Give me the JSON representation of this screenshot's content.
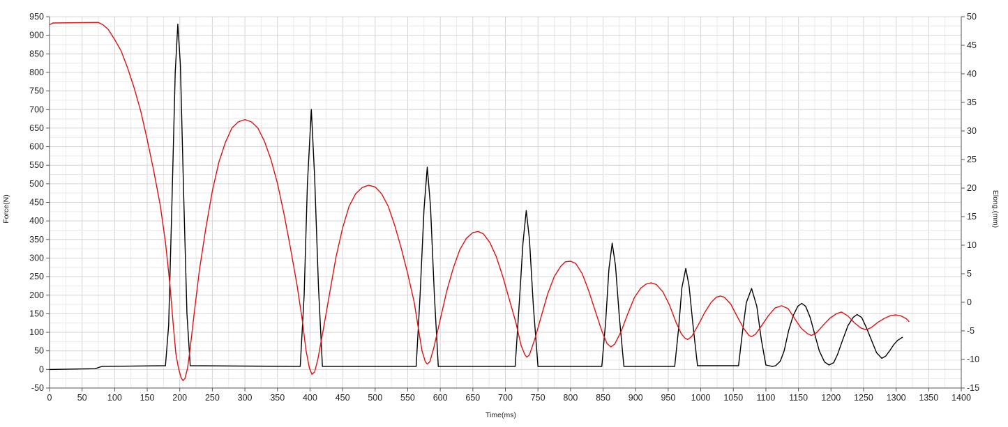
{
  "chart_data": {
    "type": "line",
    "title": "",
    "xlabel": "Time(ms)",
    "ylabel": "Force(N)",
    "y2label": "Elong.(mm)",
    "xlim": [
      0,
      1400
    ],
    "ylim": [
      -50,
      950
    ],
    "y2lim": [
      -15,
      50
    ],
    "grid": true,
    "legend": "none",
    "x_ticks": [
      "0",
      "50",
      "100",
      "150",
      "200",
      "250",
      "300",
      "350",
      "400",
      "450",
      "500",
      "550",
      "600",
      "650",
      "700",
      "750",
      "800",
      "850",
      "900",
      "950",
      "1000",
      "1050",
      "1100",
      "1150",
      "1200",
      "1250",
      "1300",
      "1350",
      "1400"
    ],
    "y_ticks": [
      "-50",
      "0",
      "50",
      "100",
      "150",
      "200",
      "250",
      "300",
      "350",
      "400",
      "450",
      "500",
      "550",
      "600",
      "650",
      "700",
      "750",
      "800",
      "850",
      "900",
      "950"
    ],
    "y2_ticks": [
      "-15",
      "-10",
      "-5",
      "0",
      "5",
      "10",
      "15",
      "20",
      "25",
      "30",
      "35",
      "40",
      "45",
      "50"
    ],
    "colors": {
      "force": "#000000",
      "elong": "#e01010",
      "grid": "#d4d4d4",
      "axis": "#555555"
    },
    "series": [
      {
        "axis": "left",
        "color": "#000000",
        "points": [
          [
            0,
            0
          ],
          [
            70,
            2
          ],
          [
            80,
            8
          ],
          [
            178,
            10
          ],
          [
            183,
            120
          ],
          [
            188,
            450
          ],
          [
            193,
            800
          ],
          [
            197,
            930
          ],
          [
            201,
            820
          ],
          [
            206,
            470
          ],
          [
            211,
            150
          ],
          [
            216,
            10
          ],
          [
            385,
            8
          ],
          [
            391,
            200
          ],
          [
            396,
            500
          ],
          [
            402,
            700
          ],
          [
            407,
            520
          ],
          [
            413,
            220
          ],
          [
            419,
            8
          ],
          [
            563,
            8
          ],
          [
            569,
            200
          ],
          [
            575,
            430
          ],
          [
            580,
            545
          ],
          [
            585,
            440
          ],
          [
            591,
            200
          ],
          [
            597,
            8
          ],
          [
            715,
            8
          ],
          [
            721,
            170
          ],
          [
            727,
            340
          ],
          [
            732,
            428
          ],
          [
            737,
            350
          ],
          [
            743,
            170
          ],
          [
            750,
            8
          ],
          [
            848,
            8
          ],
          [
            854,
            130
          ],
          [
            859,
            270
          ],
          [
            864,
            340
          ],
          [
            869,
            280
          ],
          [
            875,
            140
          ],
          [
            882,
            8
          ],
          [
            960,
            8
          ],
          [
            966,
            110
          ],
          [
            971,
            220
          ],
          [
            977,
            272
          ],
          [
            982,
            225
          ],
          [
            988,
            120
          ],
          [
            995,
            10
          ],
          [
            1058,
            10
          ],
          [
            1064,
            100
          ],
          [
            1070,
            180
          ],
          [
            1078,
            218
          ],
          [
            1086,
            170
          ],
          [
            1093,
            80
          ],
          [
            1100,
            12
          ],
          [
            1110,
            8
          ],
          [
            1115,
            10
          ],
          [
            1122,
            22
          ],
          [
            1128,
            50
          ],
          [
            1135,
            105
          ],
          [
            1142,
            145
          ],
          [
            1149,
            170
          ],
          [
            1155,
            178
          ],
          [
            1161,
            170
          ],
          [
            1168,
            140
          ],
          [
            1175,
            95
          ],
          [
            1182,
            50
          ],
          [
            1190,
            20
          ],
          [
            1197,
            12
          ],
          [
            1204,
            18
          ],
          [
            1210,
            40
          ],
          [
            1218,
            80
          ],
          [
            1226,
            118
          ],
          [
            1234,
            140
          ],
          [
            1240,
            148
          ],
          [
            1247,
            140
          ],
          [
            1255,
            110
          ],
          [
            1263,
            75
          ],
          [
            1270,
            45
          ],
          [
            1278,
            30
          ],
          [
            1284,
            36
          ],
          [
            1290,
            50
          ],
          [
            1296,
            66
          ],
          [
            1302,
            78
          ],
          [
            1310,
            87
          ]
        ]
      },
      {
        "axis": "right",
        "color": "#e01010",
        "points": [
          [
            0,
            48.6
          ],
          [
            5,
            48.9
          ],
          [
            75,
            49.0
          ],
          [
            82,
            48.6
          ],
          [
            90,
            47.8
          ],
          [
            100,
            46.0
          ],
          [
            110,
            44.0
          ],
          [
            120,
            41.0
          ],
          [
            130,
            37.5
          ],
          [
            140,
            33.5
          ],
          [
            150,
            28.5
          ],
          [
            160,
            23.0
          ],
          [
            170,
            17.0
          ],
          [
            178,
            10.5
          ],
          [
            185,
            3.0
          ],
          [
            190,
            -4.0
          ],
          [
            194,
            -9.0
          ],
          [
            198,
            -11.5
          ],
          [
            202,
            -13.2
          ],
          [
            205,
            -13.7
          ],
          [
            208,
            -13.3
          ],
          [
            212,
            -11.5
          ],
          [
            216,
            -8.0
          ],
          [
            222,
            -2.0
          ],
          [
            230,
            5.5
          ],
          [
            240,
            13.0
          ],
          [
            250,
            19.5
          ],
          [
            260,
            24.5
          ],
          [
            270,
            28.0
          ],
          [
            280,
            30.5
          ],
          [
            290,
            31.6
          ],
          [
            300,
            32.0
          ],
          [
            310,
            31.6
          ],
          [
            320,
            30.5
          ],
          [
            330,
            28.2
          ],
          [
            340,
            25.0
          ],
          [
            350,
            20.8
          ],
          [
            360,
            15.5
          ],
          [
            370,
            9.5
          ],
          [
            380,
            3.0
          ],
          [
            388,
            -3.0
          ],
          [
            394,
            -8.5
          ],
          [
            399,
            -11.5
          ],
          [
            403,
            -12.6
          ],
          [
            407,
            -12.2
          ],
          [
            412,
            -10.0
          ],
          [
            420,
            -5.0
          ],
          [
            430,
            1.5
          ],
          [
            440,
            8.0
          ],
          [
            450,
            13.0
          ],
          [
            460,
            16.8
          ],
          [
            470,
            19.0
          ],
          [
            480,
            20.1
          ],
          [
            490,
            20.5
          ],
          [
            500,
            20.2
          ],
          [
            510,
            19.0
          ],
          [
            520,
            16.8
          ],
          [
            530,
            13.5
          ],
          [
            540,
            9.5
          ],
          [
            550,
            5.0
          ],
          [
            560,
            0.0
          ],
          [
            567,
            -5.0
          ],
          [
            572,
            -8.5
          ],
          [
            577,
            -10.4
          ],
          [
            580,
            -10.8
          ],
          [
            584,
            -10.4
          ],
          [
            590,
            -8.0
          ],
          [
            600,
            -3.0
          ],
          [
            610,
            2.0
          ],
          [
            620,
            6.0
          ],
          [
            630,
            9.2
          ],
          [
            640,
            11.2
          ],
          [
            650,
            12.2
          ],
          [
            658,
            12.4
          ],
          [
            666,
            12.0
          ],
          [
            676,
            10.5
          ],
          [
            686,
            8.0
          ],
          [
            696,
            4.5
          ],
          [
            706,
            0.5
          ],
          [
            716,
            -3.5
          ],
          [
            724,
            -7.5
          ],
          [
            730,
            -9.2
          ],
          [
            733,
            -9.6
          ],
          [
            737,
            -9.2
          ],
          [
            745,
            -6.5
          ],
          [
            755,
            -2.5
          ],
          [
            765,
            1.5
          ],
          [
            775,
            4.5
          ],
          [
            785,
            6.3
          ],
          [
            792,
            7.1
          ],
          [
            800,
            7.2
          ],
          [
            808,
            6.8
          ],
          [
            818,
            5.0
          ],
          [
            828,
            2.0
          ],
          [
            838,
            -1.5
          ],
          [
            848,
            -5.0
          ],
          [
            856,
            -7.2
          ],
          [
            862,
            -7.8
          ],
          [
            868,
            -7.3
          ],
          [
            878,
            -5.0
          ],
          [
            888,
            -2.0
          ],
          [
            898,
            0.8
          ],
          [
            908,
            2.5
          ],
          [
            916,
            3.2
          ],
          [
            924,
            3.4
          ],
          [
            932,
            3.1
          ],
          [
            942,
            1.8
          ],
          [
            952,
            -0.5
          ],
          [
            962,
            -3.5
          ],
          [
            970,
            -5.5
          ],
          [
            976,
            -6.3
          ],
          [
            980,
            -6.5
          ],
          [
            986,
            -6.0
          ],
          [
            996,
            -4.0
          ],
          [
            1006,
            -1.8
          ],
          [
            1016,
            0.0
          ],
          [
            1024,
            0.9
          ],
          [
            1030,
            1.1
          ],
          [
            1036,
            0.9
          ],
          [
            1046,
            -0.3
          ],
          [
            1056,
            -2.5
          ],
          [
            1066,
            -4.6
          ],
          [
            1074,
            -5.8
          ],
          [
            1078,
            -6.0
          ],
          [
            1084,
            -5.6
          ],
          [
            1094,
            -4.0
          ],
          [
            1104,
            -2.3
          ],
          [
            1114,
            -1.0
          ],
          [
            1124,
            -0.6
          ],
          [
            1134,
            -1.1
          ],
          [
            1144,
            -2.8
          ],
          [
            1154,
            -4.5
          ],
          [
            1164,
            -5.5
          ],
          [
            1170,
            -5.8
          ],
          [
            1178,
            -5.3
          ],
          [
            1188,
            -4.0
          ],
          [
            1198,
            -2.8
          ],
          [
            1208,
            -2.0
          ],
          [
            1216,
            -1.7
          ],
          [
            1226,
            -2.4
          ],
          [
            1236,
            -3.6
          ],
          [
            1246,
            -4.5
          ],
          [
            1254,
            -4.8
          ],
          [
            1262,
            -4.4
          ],
          [
            1272,
            -3.5
          ],
          [
            1282,
            -2.8
          ],
          [
            1292,
            -2.3
          ],
          [
            1300,
            -2.2
          ],
          [
            1308,
            -2.4
          ],
          [
            1316,
            -2.9
          ],
          [
            1320,
            -3.4
          ]
        ]
      }
    ]
  }
}
